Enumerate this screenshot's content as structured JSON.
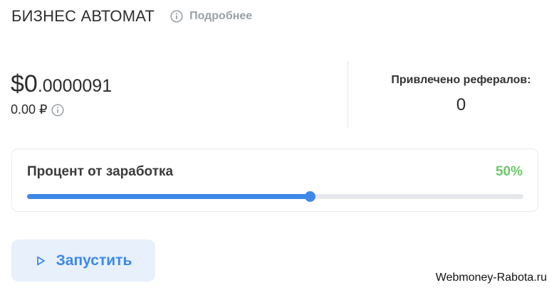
{
  "header": {
    "title": "БИЗНЕС АВТОМАТ",
    "more_label": "Подробнее"
  },
  "balance": {
    "usd_main": "$0",
    "usd_fraction": ".0000091",
    "rub": "0.00 ₽"
  },
  "referrals": {
    "label": "Привлечено рефералов:",
    "value": "0"
  },
  "earnings_percent": {
    "label": "Процент от заработка",
    "value_label": "50%",
    "slider_fraction": 0.57
  },
  "actions": {
    "start_label": "Запустить"
  },
  "watermark": "Webmoney-Rabota.ru",
  "colors": {
    "accent": "#3d88e8",
    "percent_green": "#6cc86b",
    "button_bg": "#e7f0fb"
  },
  "icons": {
    "more": "info-icon",
    "rub_info": "info-icon",
    "start": "play-icon"
  }
}
